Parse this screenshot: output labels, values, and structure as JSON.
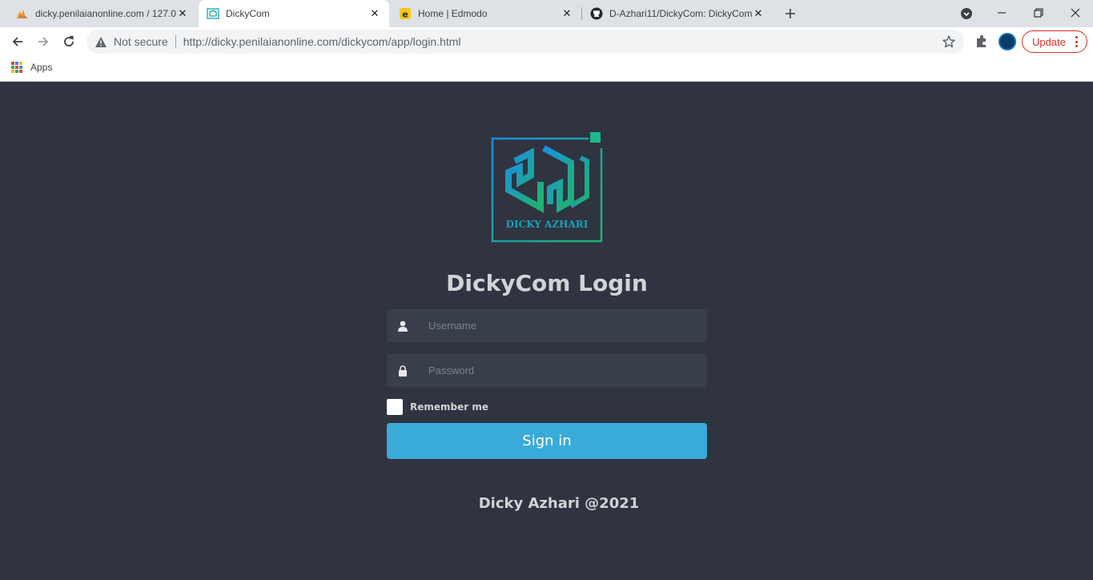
{
  "browser": {
    "tabs": [
      {
        "title": "dicky.penilaianonline.com / 127.0",
        "favicon": "phpmyadmin-icon"
      },
      {
        "title": "DickyCom",
        "favicon": "dickycom-icon",
        "active": true
      },
      {
        "title": "Home | Edmodo",
        "favicon": "edmodo-icon"
      },
      {
        "title": "D-Azhari11/DickyCom: DickyCom",
        "favicon": "github-icon"
      }
    ],
    "address": {
      "security_label": "Not secure",
      "url": "http://dicky.penilaianonline.com/dickycom/app/login.html"
    },
    "update_label": "Update",
    "bookmarks": {
      "apps_label": "Apps"
    }
  },
  "login": {
    "logo_text": "DICKY AZHARI",
    "title": "DickyCom Login",
    "username_placeholder": "Username",
    "password_placeholder": "Password",
    "remember_label": "Remember me",
    "signin_label": "Sign in",
    "footer": "Dicky Azhari @2021"
  },
  "colors": {
    "page_bg": "#2f3440",
    "field_bg": "#393e4b",
    "accent": "#3aaad8",
    "text": "#d1d3d6",
    "update_red": "#d93025"
  }
}
